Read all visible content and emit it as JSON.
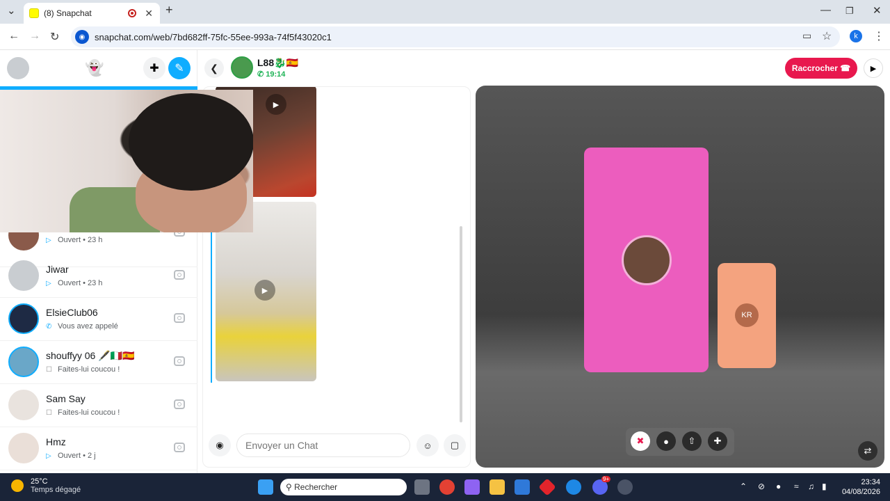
{
  "browser": {
    "tab_title": "(8) Snapchat",
    "url": "snapchat.com/web/7bd682ff-75fc-55ee-993a-74f5f43020c1",
    "profile_initial": "k"
  },
  "header": {
    "contact_name": "L88🐉🇪🇸",
    "call_duration": "19:14",
    "hangup_label": "Raccrocher"
  },
  "chats": [
    {
      "name": "",
      "status": "Ouvert • 23 h",
      "status_icon": "sent-arrow-icon",
      "avatar_color": "#8a5a4a"
    },
    {
      "name": "Jiwar",
      "status": "Ouvert • 23 h",
      "status_icon": "sent-arrow-icon",
      "avatar_color": "#c9cdd1"
    },
    {
      "name": "ElsieClub06",
      "status": "Vous avez appelé",
      "status_icon": "call-icon",
      "avatar_color": "#1e2a44"
    },
    {
      "name": "shouffyy 06 🖋️🇮🇹🇪🇸",
      "status": "Faites-lui coucou !",
      "status_icon": "chat-bubble-icon",
      "avatar_color": "#6aa7c8"
    },
    {
      "name": "Sam Say",
      "status": "Faites-lui coucou !",
      "status_icon": "chat-bubble-icon",
      "avatar_color": "#e9e3de"
    },
    {
      "name": "Hmz",
      "status": "Ouvert • 2 j",
      "status_icon": "sent-arrow-icon",
      "avatar_color": "#eadfd8"
    }
  ],
  "composer": {
    "placeholder": "Envoyer un Chat"
  },
  "call": {
    "remote_initials": "KR",
    "tile_colors": {
      "main": "#ec5dbe",
      "secondary": "#f4a37f"
    }
  },
  "taskbar": {
    "temperature": "25°C",
    "weather_text": "Temps dégagé",
    "search_placeholder": "Rechercher",
    "time": "23:34",
    "date": "04/08/2026",
    "discord_badge": "9+"
  },
  "colors": {
    "accent_blue": "#0fadff",
    "hangup_red": "#e8184e",
    "call_green": "#1db355"
  }
}
